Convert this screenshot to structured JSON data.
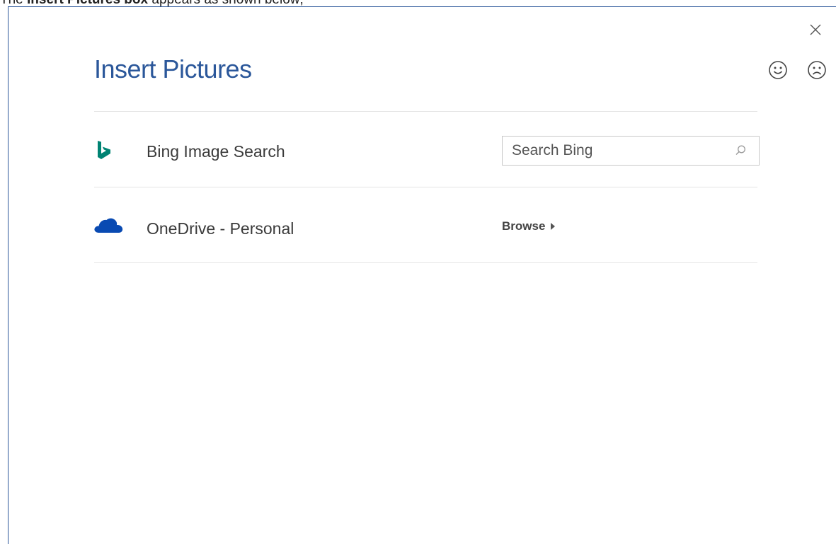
{
  "caption": {
    "prefix": "The ",
    "bold": "Insert Pictures box",
    "suffix": " appears as shown below;"
  },
  "dialog": {
    "title": "Insert Pictures",
    "close_icon": "close-icon",
    "feedback": {
      "smile_icon": "smile-icon",
      "frown_icon": "frown-icon"
    }
  },
  "sources": [
    {
      "icon": "bing-icon",
      "label": "Bing Image Search",
      "search_placeholder": "Search Bing",
      "search_value": ""
    },
    {
      "icon": "onedrive-icon",
      "label": "OneDrive - Personal",
      "action_label": "Browse"
    }
  ],
  "colors": {
    "title": "#2b579a",
    "bing": "#008373",
    "onedrive": "#094ab2",
    "border": "#2b579a"
  }
}
